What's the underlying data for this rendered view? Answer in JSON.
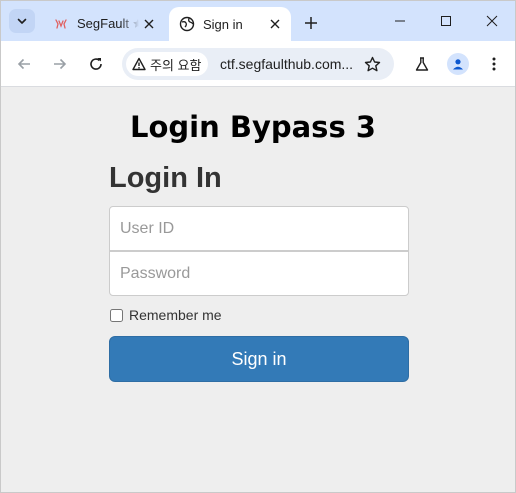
{
  "browser": {
    "tabs": [
      {
        "title": "SegFault 🟊",
        "active": false
      },
      {
        "title": "Sign in",
        "active": true
      }
    ],
    "address_bar": {
      "security_label": "주의 요함",
      "url": "ctf.segfaulthub.com..."
    }
  },
  "page": {
    "heading": "Login Bypass 3",
    "form": {
      "title": "Login In",
      "user_placeholder": "User ID",
      "password_placeholder": "Password",
      "remember_label": "Remember me",
      "remember_checked": false,
      "submit_label": "Sign in"
    }
  },
  "colors": {
    "primary_button": "#337ab7",
    "page_background": "#eeeeee",
    "tabstrip": "#d3e3fd"
  }
}
